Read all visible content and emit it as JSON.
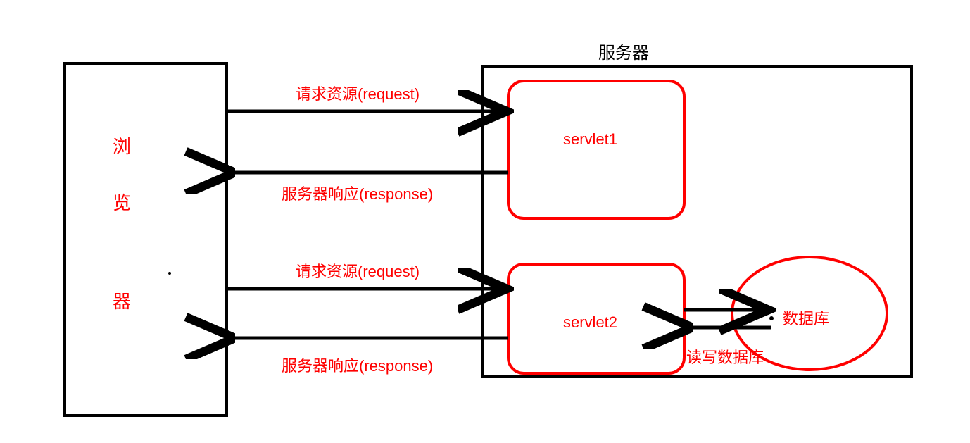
{
  "browser": {
    "label": "浏览器"
  },
  "server": {
    "title": "服务器",
    "servlet1": "servlet1",
    "servlet2": "servlet2",
    "database": "数据库",
    "db_rw": "读写数据库"
  },
  "arrows": {
    "request": "请求资源(request)",
    "response": "服务器响应(response)"
  }
}
